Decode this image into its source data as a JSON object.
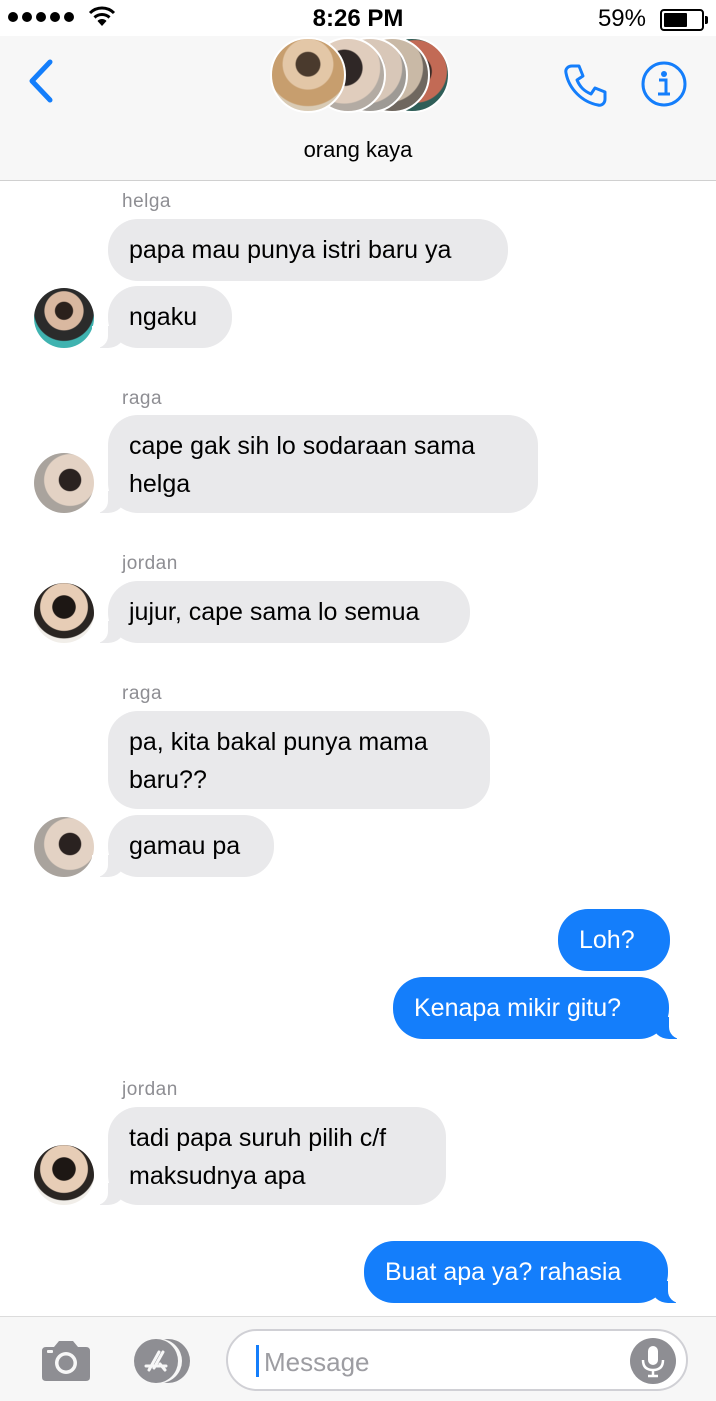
{
  "status_bar": {
    "time": "8:26 PM",
    "battery": "59%"
  },
  "header": {
    "group_name": "orang kaya",
    "icons": [
      "back-chevron-icon",
      "phone-icon",
      "info-icon"
    ]
  },
  "messages": [
    {
      "sender": "helga",
      "text": "papa mau punya istri baru ya",
      "direction": "in"
    },
    {
      "text": "ngaku",
      "direction": "in"
    },
    {
      "sender": "raga",
      "text": "cape gak sih lo sodaraan sama helga",
      "direction": "in"
    },
    {
      "sender": "jordan",
      "text": "jujur, cape sama lo semua",
      "direction": "in"
    },
    {
      "sender": "raga",
      "text": "pa, kita bakal punya mama baru??",
      "direction": "in"
    },
    {
      "text": "gamau pa",
      "direction": "in"
    },
    {
      "text": "Loh?",
      "direction": "out"
    },
    {
      "text": "Kenapa mikir gitu?",
      "direction": "out"
    },
    {
      "sender": "jordan",
      "text": "tadi papa suruh pilih c/f maksudnya apa",
      "direction": "in"
    },
    {
      "text": "Buat apa ya? rahasia",
      "direction": "out"
    }
  ],
  "composer": {
    "placeholder": "Message"
  },
  "colors": {
    "accent": "#147efb",
    "incoming_bubble": "#e9e9eb",
    "outgoing_bubble": "#147efb"
  }
}
